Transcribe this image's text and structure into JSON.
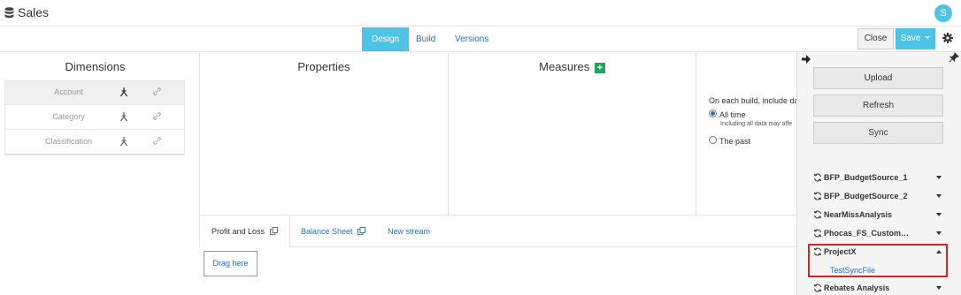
{
  "header": {
    "title": "Sales",
    "avatar_initial": "S"
  },
  "tabs": [
    {
      "label": "Design",
      "active": true
    },
    {
      "label": "Build",
      "active": false
    },
    {
      "label": "Versions",
      "active": false
    }
  ],
  "toolbar": {
    "close_label": "Close",
    "save_label": "Save"
  },
  "dimensions": {
    "title": "Dimensions",
    "items": [
      {
        "label": "Account"
      },
      {
        "label": "Category"
      },
      {
        "label": "Classification"
      }
    ]
  },
  "properties": {
    "title": "Properties"
  },
  "measures": {
    "title": "Measures",
    "add_symbol": "+"
  },
  "build_options": {
    "include_text": "On each build, include da",
    "options": [
      {
        "label": "All time",
        "sub": "Including all data may affe",
        "selected": true
      },
      {
        "label": "The past",
        "sub": "",
        "selected": false
      }
    ]
  },
  "streams": {
    "tabs": [
      {
        "label": "Profit and Loss"
      },
      {
        "label": "Balance Sheet"
      },
      {
        "label": "New stream"
      }
    ],
    "drag_label": "Drag here"
  },
  "panel": {
    "buttons": [
      {
        "label": "Upload"
      },
      {
        "label": "Refresh"
      },
      {
        "label": "Sync"
      }
    ],
    "sources": [
      {
        "label": "BFP_BudgetSource_1",
        "expanded": false
      },
      {
        "label": "BFP_BudgetSource_2",
        "expanded": false
      },
      {
        "label": "NearMissAnalysis",
        "expanded": false
      },
      {
        "label": "Phocas_FS_Custom…",
        "expanded": false
      },
      {
        "label": "ProjectX",
        "expanded": true
      },
      {
        "label": "Rebates Analysis",
        "expanded": false
      }
    ],
    "projectx_file": "TestSyncFile"
  },
  "colors": {
    "accent": "#4fc3e6",
    "link": "#2a6fb5",
    "highlight": "#d9231d",
    "add": "#20a261"
  },
  "icons": [
    "database-icon",
    "gear-icon",
    "hierarchy-icon",
    "link-icon",
    "copy-icon",
    "arrow-right-icon",
    "pin-icon",
    "sync-icon",
    "caret-down-icon",
    "caret-up-icon"
  ]
}
